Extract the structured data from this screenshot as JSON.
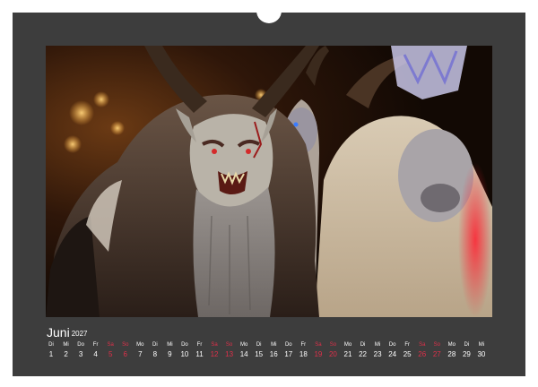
{
  "calendar": {
    "month": "Juni",
    "year": "2027",
    "days": [
      {
        "wd": "Di",
        "d": "1",
        "we": false
      },
      {
        "wd": "Mi",
        "d": "2",
        "we": false
      },
      {
        "wd": "Do",
        "d": "3",
        "we": false
      },
      {
        "wd": "Fr",
        "d": "4",
        "we": false
      },
      {
        "wd": "Sa",
        "d": "5",
        "we": true
      },
      {
        "wd": "So",
        "d": "6",
        "we": true
      },
      {
        "wd": "Mo",
        "d": "7",
        "we": false
      },
      {
        "wd": "Di",
        "d": "8",
        "we": false
      },
      {
        "wd": "Mi",
        "d": "9",
        "we": false
      },
      {
        "wd": "Do",
        "d": "10",
        "we": false
      },
      {
        "wd": "Fr",
        "d": "11",
        "we": false
      },
      {
        "wd": "Sa",
        "d": "12",
        "we": true
      },
      {
        "wd": "So",
        "d": "13",
        "we": true
      },
      {
        "wd": "Mo",
        "d": "14",
        "we": false
      },
      {
        "wd": "Di",
        "d": "15",
        "we": false
      },
      {
        "wd": "Mi",
        "d": "16",
        "we": false
      },
      {
        "wd": "Do",
        "d": "17",
        "we": false
      },
      {
        "wd": "Fr",
        "d": "18",
        "we": false
      },
      {
        "wd": "Sa",
        "d": "19",
        "we": true
      },
      {
        "wd": "So",
        "d": "20",
        "we": true
      },
      {
        "wd": "Mo",
        "d": "21",
        "we": false
      },
      {
        "wd": "Di",
        "d": "22",
        "we": false
      },
      {
        "wd": "Mi",
        "d": "23",
        "we": false
      },
      {
        "wd": "Do",
        "d": "24",
        "we": false
      },
      {
        "wd": "Fr",
        "d": "25",
        "we": false
      },
      {
        "wd": "Sa",
        "d": "26",
        "we": true
      },
      {
        "wd": "So",
        "d": "27",
        "we": true
      },
      {
        "wd": "Mo",
        "d": "28",
        "we": false
      },
      {
        "wd": "Di",
        "d": "29",
        "we": false
      },
      {
        "wd": "Mi",
        "d": "30",
        "we": false
      }
    ]
  },
  "photo": {
    "subject": "krampus-masks-photo"
  },
  "colors": {
    "page_background": "#3d3d3d",
    "text": "#ffffff",
    "weekend": "#e0304a"
  }
}
